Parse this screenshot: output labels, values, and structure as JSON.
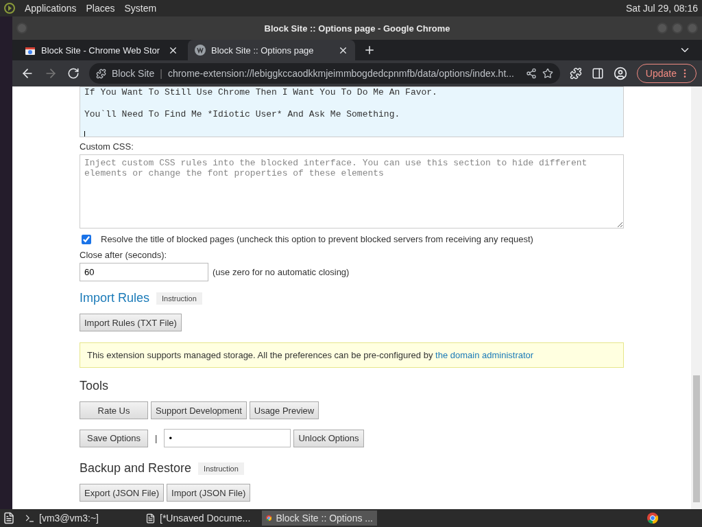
{
  "top_panel": {
    "menus": [
      "Applications",
      "Places",
      "System"
    ],
    "clock": "Sat Jul 29, 08:16"
  },
  "window": {
    "title": "Block Site :: Options page - Google Chrome"
  },
  "tabs": [
    {
      "label": "Block Site - Chrome Web Stor",
      "selected": false
    },
    {
      "label": "Block Site :: Options page",
      "selected": true
    }
  ],
  "toolbar": {
    "site": "Block Site",
    "divider": "|",
    "url": "chrome-extension://lebiggkccaodkkmjeimmbogdedcpnmfb/data/options/index.ht...",
    "update": "Update"
  },
  "message_box": {
    "lines": [
      "If You Want To Still Use Chrome Then I Want You To Do Me An Favor.",
      "You`ll Need To Find Me *Idiotic User* And Ask Me Something."
    ]
  },
  "custom_css": {
    "label": "Custom CSS:",
    "placeholder": "Inject custom CSS rules into the blocked interface. You can use this section to hide different elements or change the font properties of these elements"
  },
  "resolve_title": {
    "label": "Resolve the title of blocked pages (uncheck this option to prevent blocked servers from receiving any request)",
    "checked": true
  },
  "close_after": {
    "label": "Close after (seconds):",
    "value": "60",
    "hint": "(use zero for no automatic closing)"
  },
  "import_rules": {
    "heading": "Import Rules",
    "badge": "Instruction",
    "button": "Import Rules (TXT File)"
  },
  "notice": {
    "text": "This extension supports managed storage. All the preferences can be pre-configured by",
    "link": "the domain administrator"
  },
  "tools": {
    "heading": "Tools",
    "buttons": [
      "Rate Us",
      "Support Development",
      "Usage Preview"
    ],
    "save": "Save Options",
    "separator": "|",
    "password": "•",
    "unlock": "Unlock Options"
  },
  "backup": {
    "heading": "Backup and Restore",
    "badge": "Instruction",
    "buttons": [
      "Export (JSON File)",
      "Import (JSON File)"
    ]
  },
  "taskbar": {
    "items": [
      {
        "label": "[vm3@vm3:~]",
        "selected": false
      },
      {
        "label": "[*Unsaved Docume...",
        "selected": false
      },
      {
        "label": "Block Site :: Options ...",
        "selected": true
      }
    ]
  }
}
